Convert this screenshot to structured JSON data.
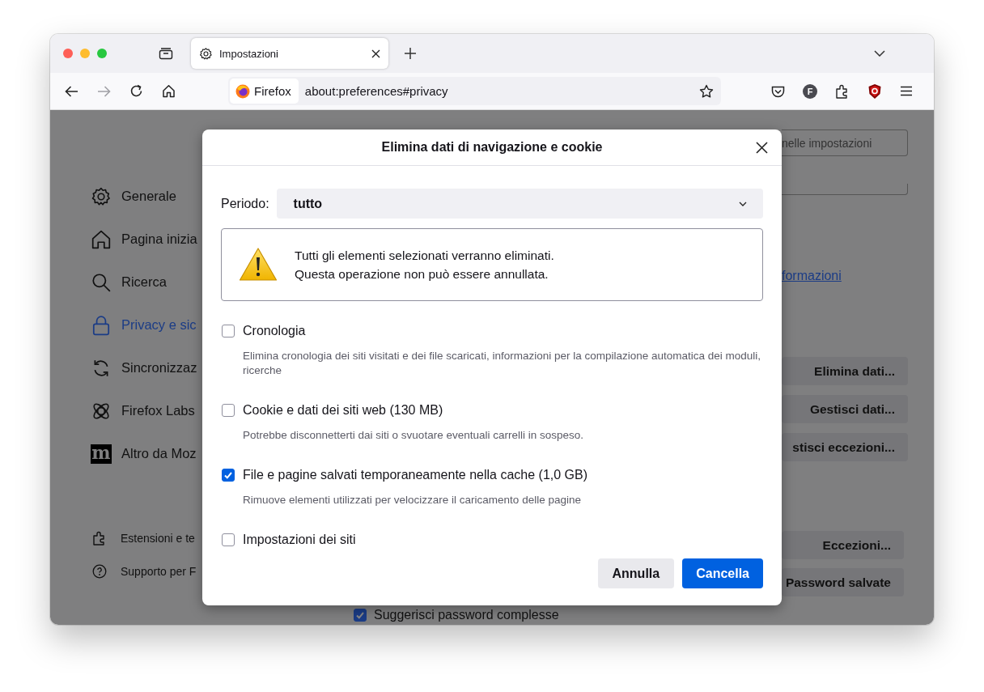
{
  "tabs": [
    {
      "label": "Impostazioni",
      "selected": true
    }
  ],
  "toolbar": {
    "identity": "Firefox",
    "url": "about:preferences#privacy",
    "forward_disabled": true,
    "account_initial": "F"
  },
  "sidebar": {
    "items": [
      {
        "label": "Generale",
        "selected": false
      },
      {
        "label": "Pagina inizia",
        "selected": false
      },
      {
        "label": "Ricerca",
        "selected": false
      },
      {
        "label": "Privacy e sic",
        "selected": true
      },
      {
        "label": "Sincronizzaz",
        "selected": false
      },
      {
        "label": "Firefox Labs",
        "selected": false
      },
      {
        "label": "Altro da Moz",
        "selected": false,
        "badge": "m"
      }
    ],
    "footer": [
      {
        "label": "Estensioni e te"
      },
      {
        "label": "Supporto per F"
      }
    ]
  },
  "background_page": {
    "search": {
      "placeholder": "nelle impostazioni"
    },
    "link": "formazioni",
    "buttons_upper": [
      "Elimina dati...",
      "Gestisci dati...",
      "stisci eccezioni..."
    ],
    "buttons_lower": [
      "Eccezioni...",
      "Password salvate"
    ],
    "checkbox": {
      "label": "Suggerisci password complesse",
      "checked": true
    }
  },
  "dialog": {
    "title": "Elimina dati di navigazione e cookie",
    "period_label": "Periodo:",
    "period_value": "tutto",
    "warning": [
      "Tutti gli elementi selezionati verranno eliminati.",
      "Questa operazione non può essere annullata."
    ],
    "options": [
      {
        "label": "Cronologia",
        "description": "Elimina cronologia dei siti visitati e dei file scaricati, informazioni per la compilazione automatica dei moduli, ricerche",
        "checked": false
      },
      {
        "label": "Cookie e dati dei siti web (130 MB)",
        "description": "Potrebbe disconnetterti dai siti o svuotare eventuali carrelli in sospeso.",
        "checked": false
      },
      {
        "label": "File e pagine salvati temporaneamente nella cache (1,0 GB)",
        "description": "Rimuove elementi utilizzati per velocizzare il caricamento delle pagine",
        "checked": true
      },
      {
        "label": "Impostazioni dei siti",
        "checked": false
      }
    ],
    "buttons": [
      {
        "label": "Annulla",
        "kind": "secondary"
      },
      {
        "label": "Cancella",
        "kind": "primary"
      }
    ]
  }
}
